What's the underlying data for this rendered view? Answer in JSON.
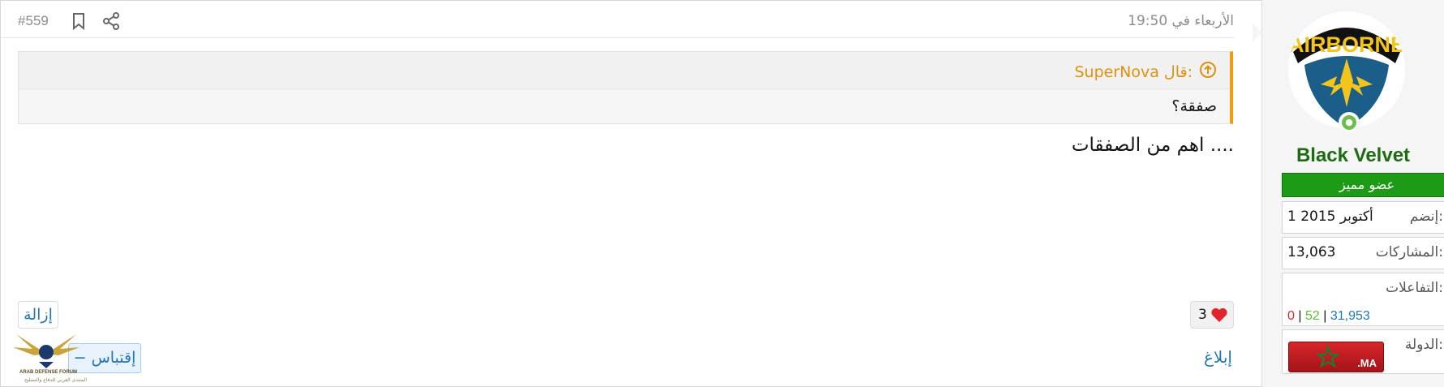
{
  "post": {
    "date": "الأربعاء في 19:50",
    "number": "#559",
    "quote": {
      "author": "SuperNova قال:",
      "text": "صفقة؟"
    },
    "message": "اهم من الصفقات ....",
    "likes_count": "3",
    "report_label": "إبلاغ",
    "remove_label": "إزالة",
    "quote_button_label": "− إقتباس"
  },
  "user": {
    "name": "Black Velvet",
    "title": "عضو مميز",
    "avatar_text": "AIRBORNE",
    "joined_label": "إنضم:",
    "joined_value": "1 أكتوبر 2015",
    "posts_label": "المشاركات:",
    "posts_value": "13,063",
    "reactions_label": "التفاعلات:",
    "reactions": [
      "31,953",
      "52",
      "0"
    ],
    "reactions_sep": "|",
    "country_label": "الدولة:",
    "country_flag_text": ".MA"
  },
  "watermark": {
    "line1": "ARAB DEFENSE FORUM",
    "line2": "المنتدى العربي للدفاع والتسليح"
  },
  "colors": {
    "accent": "#2577b1",
    "quote_border": "#f39c12",
    "username": "#1d6b12",
    "user_title_bg": "#1e9b16",
    "like": "#d62828"
  }
}
